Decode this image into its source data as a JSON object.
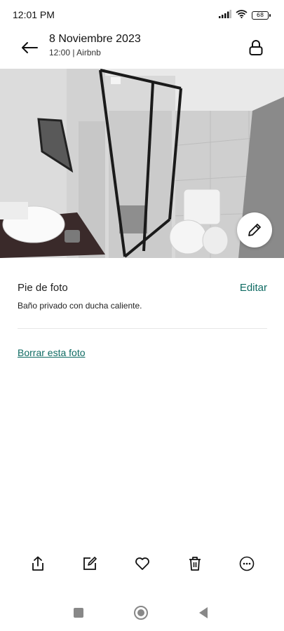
{
  "status": {
    "time": "12:01 PM",
    "battery": "68",
    "icons": [
      "signal-icon",
      "wifi-icon",
      "battery-icon"
    ]
  },
  "header": {
    "title": "8 Noviembre 2023",
    "subtitle": "12:00 | Airbnb",
    "back_icon": "back-arrow-icon",
    "lock_icon": "lock-icon"
  },
  "photo": {
    "description_icon": "bathroom-photo",
    "edit_icon": "pencil-icon"
  },
  "caption": {
    "label": "Pie de foto",
    "edit_label": "Editar",
    "text": "Baño privado con ducha caliente."
  },
  "delete_label": "Borrar esta foto",
  "actions": [
    "share-icon",
    "edit-icon",
    "heart-icon",
    "trash-icon",
    "more-icon"
  ],
  "nav": [
    "recents-icon",
    "home-icon",
    "back-icon"
  ],
  "colors": {
    "accent": "#0f6b63",
    "text": "#222222"
  }
}
